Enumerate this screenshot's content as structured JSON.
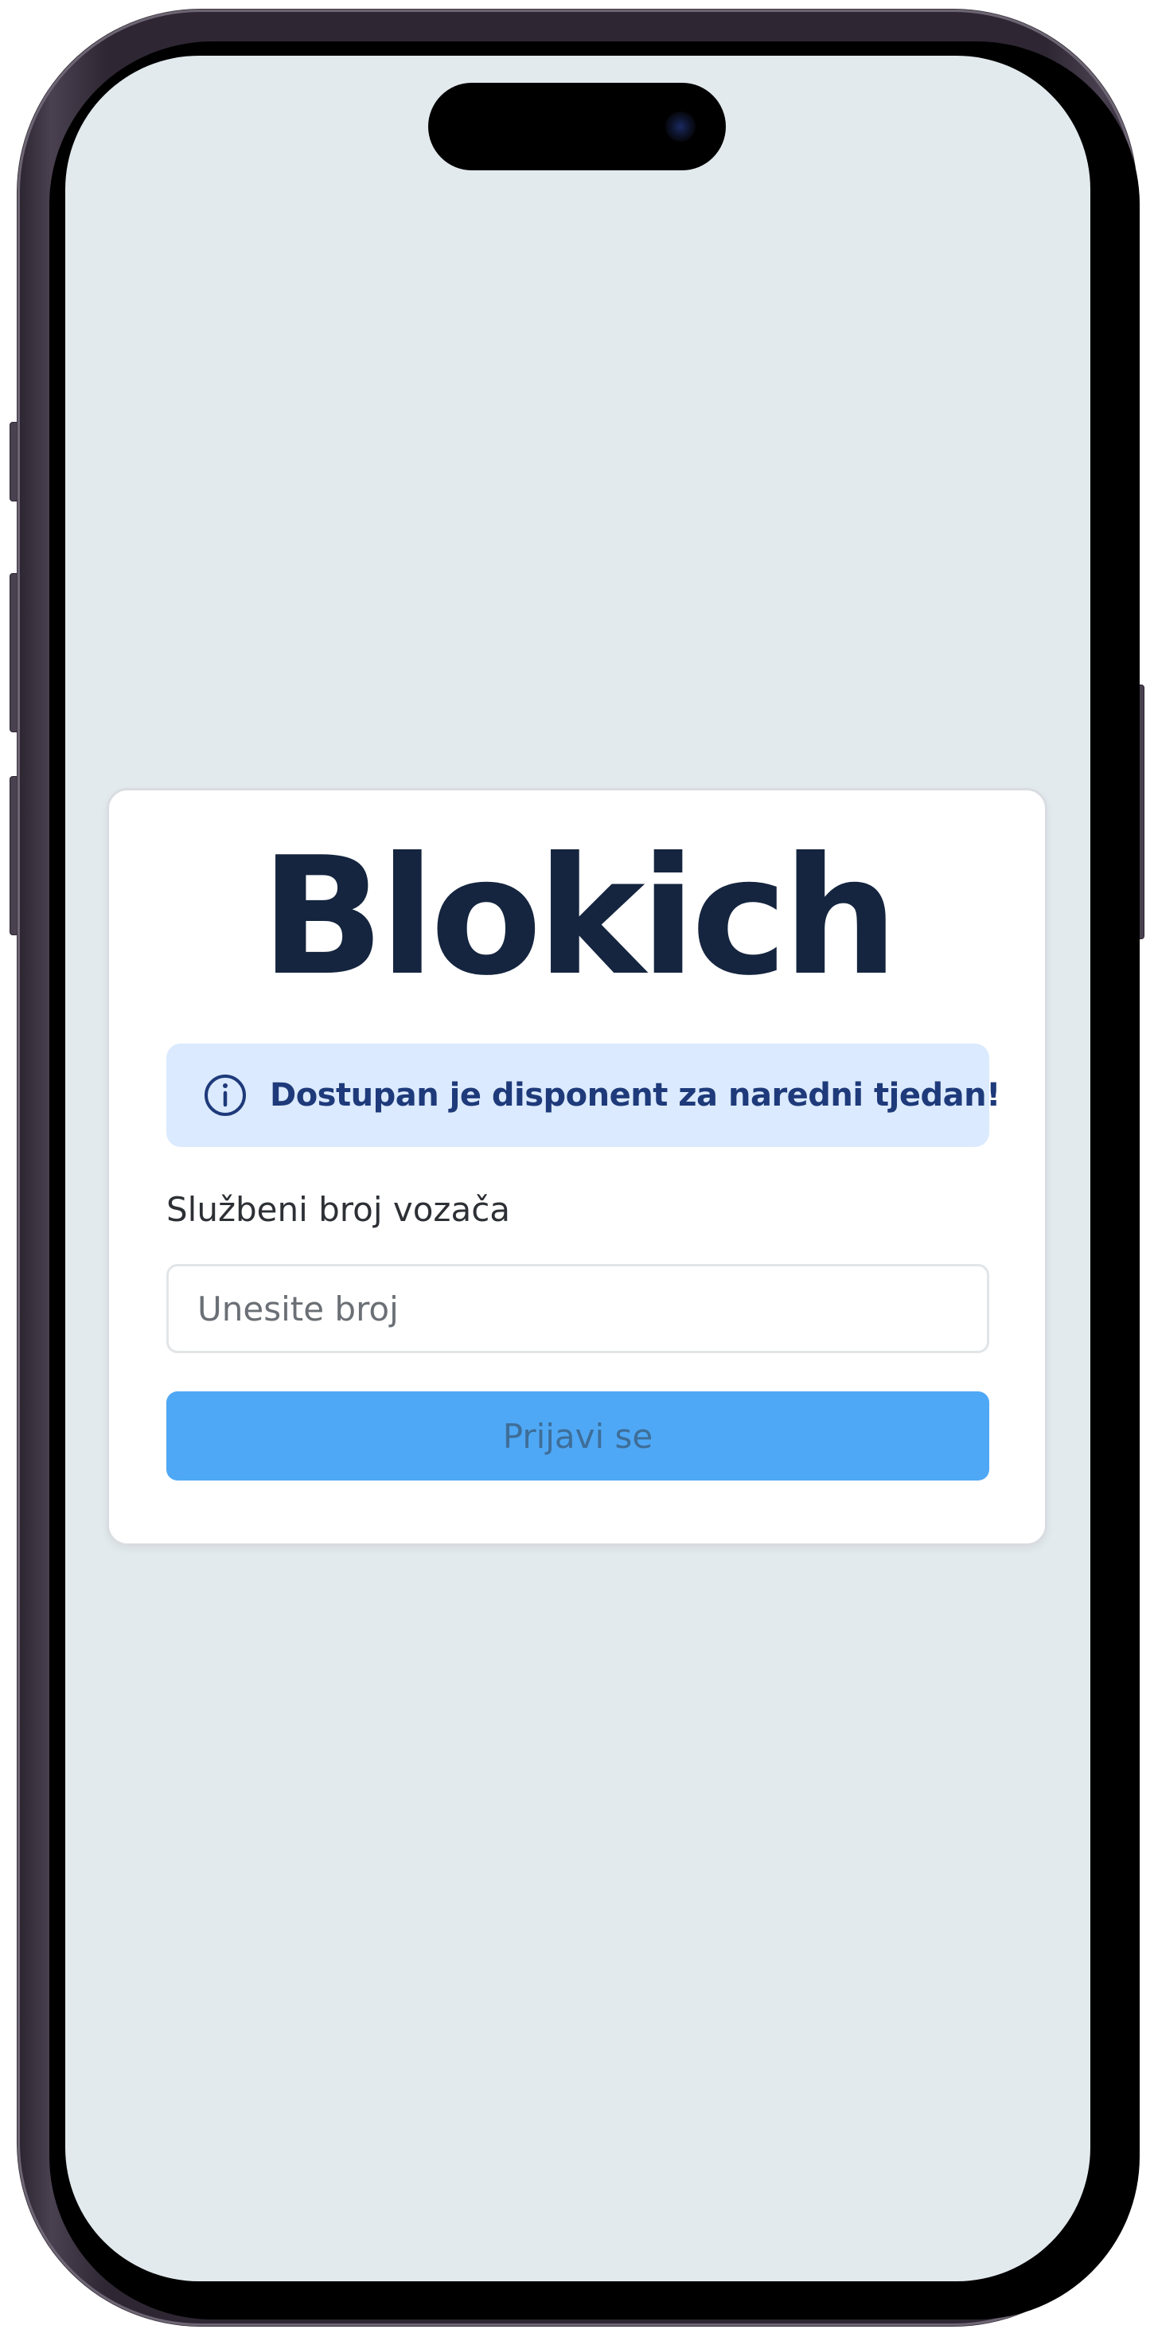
{
  "app": {
    "logo_text": "Blokich"
  },
  "alert": {
    "icon": "info-circle-icon",
    "message": "Dostupan je disponent za naredni tjedan!"
  },
  "login_form": {
    "field_label": "Službeni broj vozača",
    "input_placeholder": "Unesite broj",
    "input_value": "",
    "submit_label": "Prijavi se"
  },
  "colors": {
    "screen_background": "#e3eaee",
    "card_background": "#ffffff",
    "logo": "#15253f",
    "alert_background": "#dbeafe",
    "alert_text": "#1e3a7a",
    "button_background": "#4fa8f5",
    "button_text": "#3e6e98"
  }
}
